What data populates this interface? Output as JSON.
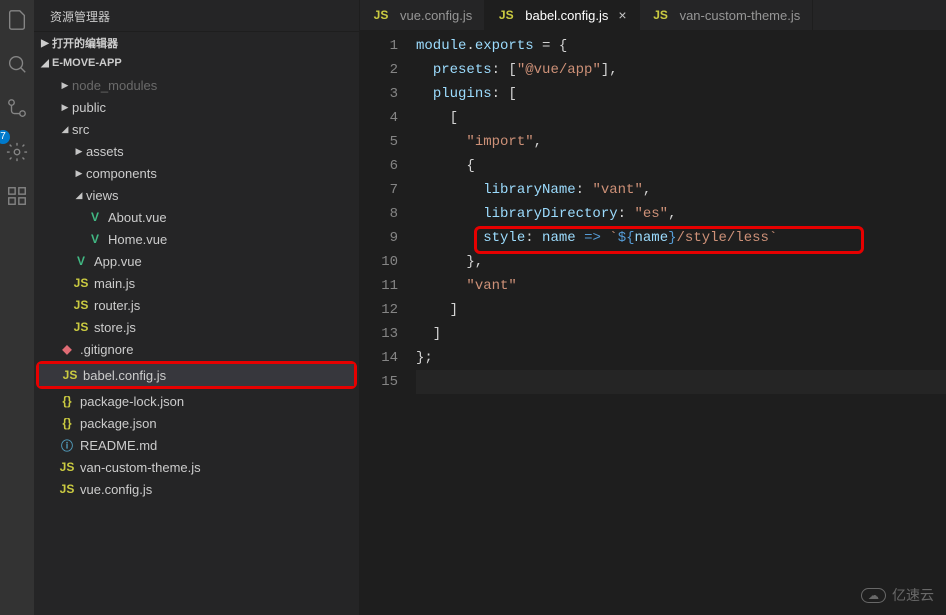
{
  "sidebar": {
    "title": "资源管理器",
    "sections": {
      "open_editors": "打开的编辑器",
      "project": "E-MOVE-APP"
    },
    "tree": {
      "node_modules": "node_modules",
      "public": "public",
      "src": "src",
      "assets": "assets",
      "components": "components",
      "views": "views",
      "about_vue": "About.vue",
      "home_vue": "Home.vue",
      "app_vue": "App.vue",
      "main_js": "main.js",
      "router_js": "router.js",
      "store_js": "store.js",
      "gitignore": ".gitignore",
      "babel_config": "babel.config.js",
      "pkg_lock": "package-lock.json",
      "pkg": "package.json",
      "readme": "README.md",
      "van_theme": "van-custom-theme.js",
      "vue_config": "vue.config.js"
    }
  },
  "badge": "7",
  "tabs": [
    {
      "label": "vue.config.js",
      "active": false
    },
    {
      "label": "babel.config.js",
      "active": true
    },
    {
      "label": "van-custom-theme.js",
      "active": false
    }
  ],
  "code": {
    "l1a": "module",
    "l1b": "exports",
    "l2a": "presets",
    "l2b": "\"@vue/app\"",
    "l3a": "plugins",
    "l5a": "\"import\"",
    "l7a": "libraryName",
    "l7b": "\"vant\"",
    "l8a": "libraryDirectory",
    "l8b": "\"es\"",
    "l9a": "style",
    "l9b": "name",
    "l9c": "`",
    "l9d": "${",
    "l9e": "name",
    "l9f": "}",
    "l9g": "/style/less",
    "l9h": "`",
    "l11a": "\"vant\""
  },
  "line_numbers": [
    "1",
    "2",
    "3",
    "4",
    "5",
    "6",
    "7",
    "8",
    "9",
    "10",
    "11",
    "12",
    "13",
    "14",
    "15"
  ],
  "watermark": "亿速云"
}
